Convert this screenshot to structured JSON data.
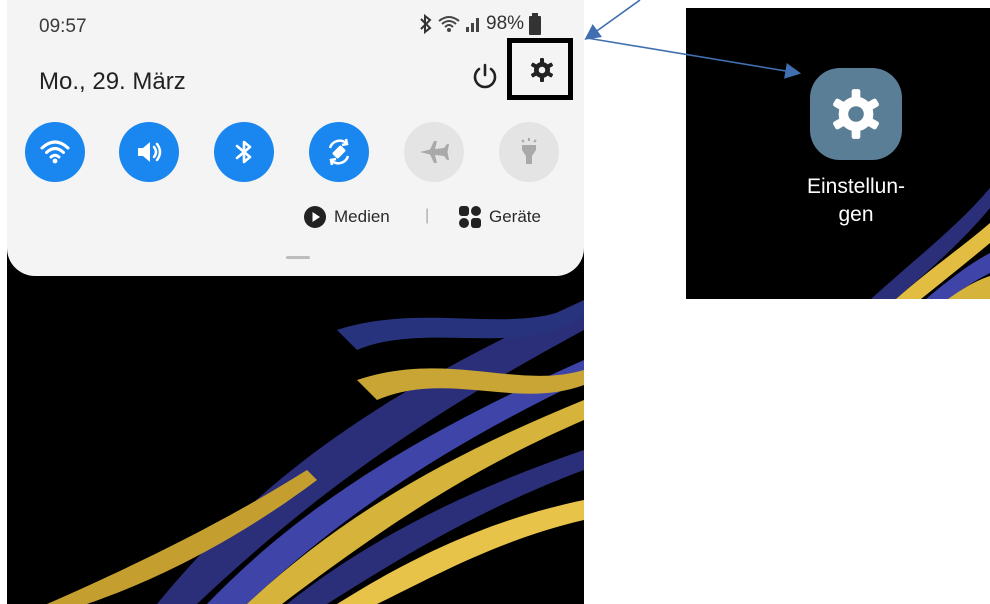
{
  "status_bar": {
    "time": "09:57",
    "battery": "98%",
    "icons": [
      "bluetooth-icon",
      "wifi-icon",
      "signal-icon",
      "battery-icon"
    ]
  },
  "panel": {
    "date": "Mo., 29. März",
    "quick_tiles": [
      {
        "name": "wifi",
        "icon": "wifi-icon",
        "state": "on"
      },
      {
        "name": "sound",
        "icon": "volume-icon",
        "state": "on"
      },
      {
        "name": "bluetooth",
        "icon": "bluetooth-icon",
        "state": "on"
      },
      {
        "name": "auto-rotate",
        "icon": "rotate-icon",
        "state": "on"
      },
      {
        "name": "airplane",
        "icon": "airplane-icon",
        "state": "off"
      },
      {
        "name": "flashlight",
        "icon": "flashlight-icon",
        "state": "off"
      }
    ],
    "media_label": "Medien",
    "separator": "|",
    "devices_label": "Geräte"
  },
  "app": {
    "label_line1": "Einstellun-",
    "label_line2": "gen",
    "icon": "settings-gear-icon"
  },
  "colors": {
    "tile_on": "#1a86f0",
    "tile_off": "#e4e4e4",
    "panel": "#f4f4f4",
    "app_icon": "#5b7e97",
    "arrow": "#3f6fb0"
  }
}
